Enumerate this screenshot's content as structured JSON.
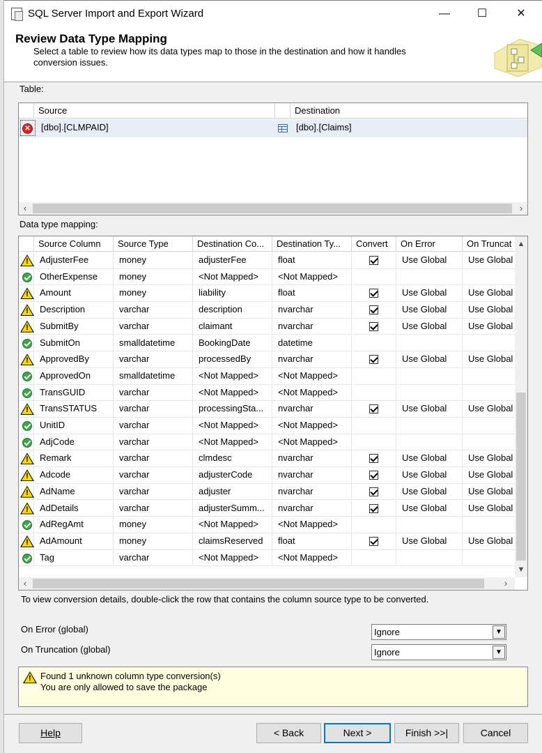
{
  "window": {
    "title": "SQL Server Import and Export Wizard",
    "minimize_glyph": "—",
    "maximize_glyph": "☐",
    "close_glyph": "✕"
  },
  "header": {
    "title": "Review Data Type Mapping",
    "subtitle": "Select a table to review how its data types map to those in the destination and how it handles conversion issues."
  },
  "table_section": {
    "label": "Table:",
    "columns": {
      "source": "Source",
      "destination": "Destination"
    },
    "rows": [
      {
        "status": "error-icon",
        "source": "[dbo].[CLMPAID]",
        "dest_icon": "table-icon",
        "destination": "[dbo].[Claims]"
      }
    ]
  },
  "mapping_section": {
    "label": "Data type mapping:",
    "columns": {
      "source_column": "Source Column",
      "source_type": "Source Type",
      "destination_column": "Destination Co...",
      "destination_type": "Destination Ty...",
      "convert": "Convert",
      "on_error": "On Error",
      "on_truncation": "On Truncat"
    },
    "rows": [
      {
        "status": "warning",
        "source_column": "AdjusterFee",
        "source_type": "money",
        "destination_column": "adjusterFee",
        "destination_type": "float",
        "convert": true,
        "on_error": "Use Global",
        "on_truncation": "Use Global"
      },
      {
        "status": "ok",
        "source_column": "OtherExpense",
        "source_type": "money",
        "destination_column": "<Not Mapped>",
        "destination_type": "<Not Mapped>",
        "convert": false,
        "on_error": "",
        "on_truncation": ""
      },
      {
        "status": "warning",
        "source_column": "Amount",
        "source_type": "money",
        "destination_column": "liability",
        "destination_type": "float",
        "convert": true,
        "on_error": "Use Global",
        "on_truncation": "Use Global"
      },
      {
        "status": "warning",
        "source_column": "Description",
        "source_type": "varchar",
        "destination_column": "description",
        "destination_type": "nvarchar",
        "convert": true,
        "on_error": "Use Global",
        "on_truncation": "Use Global"
      },
      {
        "status": "warning",
        "source_column": "SubmitBy",
        "source_type": "varchar",
        "destination_column": "claimant",
        "destination_type": "nvarchar",
        "convert": true,
        "on_error": "Use Global",
        "on_truncation": "Use Global"
      },
      {
        "status": "ok",
        "source_column": "SubmitOn",
        "source_type": "smalldatetime",
        "destination_column": "BookingDate",
        "destination_type": "datetime",
        "convert": false,
        "on_error": "",
        "on_truncation": ""
      },
      {
        "status": "warning",
        "source_column": "ApprovedBy",
        "source_type": "varchar",
        "destination_column": "processedBy",
        "destination_type": "nvarchar",
        "convert": true,
        "on_error": "Use Global",
        "on_truncation": "Use Global"
      },
      {
        "status": "ok",
        "source_column": "ApprovedOn",
        "source_type": "smalldatetime",
        "destination_column": "<Not Mapped>",
        "destination_type": "<Not Mapped>",
        "convert": false,
        "on_error": "",
        "on_truncation": ""
      },
      {
        "status": "ok",
        "source_column": "TransGUID",
        "source_type": "varchar",
        "destination_column": "<Not Mapped>",
        "destination_type": "<Not Mapped>",
        "convert": false,
        "on_error": "",
        "on_truncation": ""
      },
      {
        "status": "warning",
        "source_column": "TransSTATUS",
        "source_type": "varchar",
        "destination_column": "processingSta...",
        "destination_type": "nvarchar",
        "convert": true,
        "on_error": "Use Global",
        "on_truncation": "Use Global"
      },
      {
        "status": "ok",
        "source_column": "UnitID",
        "source_type": "varchar",
        "destination_column": "<Not Mapped>",
        "destination_type": "<Not Mapped>",
        "convert": false,
        "on_error": "",
        "on_truncation": ""
      },
      {
        "status": "ok",
        "source_column": "AdjCode",
        "source_type": "varchar",
        "destination_column": "<Not Mapped>",
        "destination_type": "<Not Mapped>",
        "convert": false,
        "on_error": "",
        "on_truncation": ""
      },
      {
        "status": "warning",
        "source_column": "Remark",
        "source_type": "varchar",
        "destination_column": "clmdesc",
        "destination_type": "nvarchar",
        "convert": true,
        "on_error": "Use Global",
        "on_truncation": "Use Global"
      },
      {
        "status": "warning",
        "source_column": "Adcode",
        "source_type": "varchar",
        "destination_column": "adjusterCode",
        "destination_type": "nvarchar",
        "convert": true,
        "on_error": "Use Global",
        "on_truncation": "Use Global"
      },
      {
        "status": "warning",
        "source_column": "AdName",
        "source_type": "varchar",
        "destination_column": "adjuster",
        "destination_type": "nvarchar",
        "convert": true,
        "on_error": "Use Global",
        "on_truncation": "Use Global"
      },
      {
        "status": "warning",
        "source_column": "AdDetails",
        "source_type": "varchar",
        "destination_column": "adjusterSumm...",
        "destination_type": "nvarchar",
        "convert": true,
        "on_error": "Use Global",
        "on_truncation": "Use Global"
      },
      {
        "status": "ok",
        "source_column": "AdRegAmt",
        "source_type": "money",
        "destination_column": "<Not Mapped>",
        "destination_type": "<Not Mapped>",
        "convert": false,
        "on_error": "",
        "on_truncation": ""
      },
      {
        "status": "warning",
        "source_column": "AdAmount",
        "source_type": "money",
        "destination_column": "claimsReserved",
        "destination_type": "float",
        "convert": true,
        "on_error": "Use Global",
        "on_truncation": "Use Global"
      },
      {
        "status": "ok",
        "source_column": "Tag",
        "source_type": "varchar",
        "destination_column": "<Not Mapped>",
        "destination_type": "<Not Mapped>",
        "convert": false,
        "on_error": "",
        "on_truncation": ""
      }
    ]
  },
  "hint": "To view conversion details, double-click the row that contains the column source type to be converted.",
  "global_options": {
    "on_error_label": "On Error (global)",
    "on_error_value": "Ignore",
    "on_truncation_label": "On Truncation (global)",
    "on_truncation_value": "Ignore"
  },
  "message": {
    "line1": "Found 1 unknown column type conversion(s)",
    "line2": "You are only allowed to save the package"
  },
  "buttons": {
    "help": "Help",
    "back": "< Back",
    "next": "Next >",
    "finish": "Finish >>|",
    "cancel": "Cancel"
  },
  "colors": {
    "warning_yellow": "#ffd800",
    "ok_green": "#3aa844",
    "error_red": "#d9262b",
    "message_bg": "#ffffe1",
    "default_button_border": "#0078d7"
  }
}
